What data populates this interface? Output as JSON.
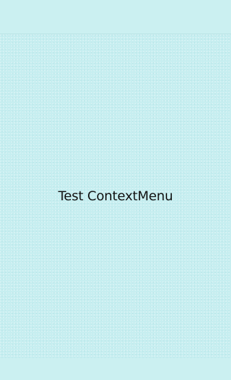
{
  "main": {
    "text": "Test ContextMenu"
  },
  "colors": {
    "background": "#cbf0f1",
    "content_background": "#c6eef0",
    "text": "#111111"
  }
}
